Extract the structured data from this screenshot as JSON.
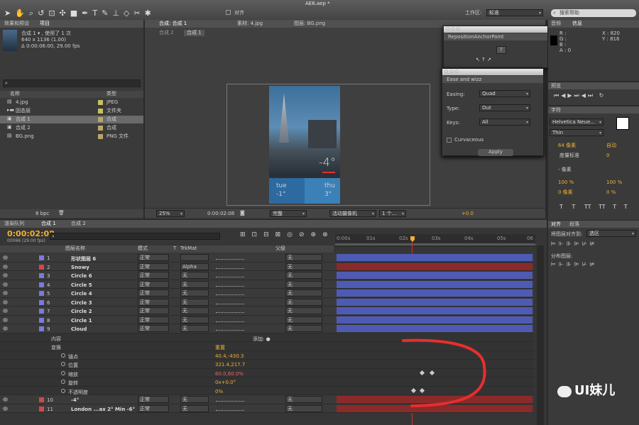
{
  "app": {
    "title": "AE6.aep *",
    "workspace_label": "工作区:",
    "workspace_value": "标准",
    "search_placeholder": "搜索帮助",
    "align_label": "对齐"
  },
  "project": {
    "tabs": [
      "效果和预设",
      "项目"
    ],
    "comp_name": "合成 1 ▾ , 使用了 1 次",
    "comp_size": "640 x 1136 (1.00)",
    "comp_duration": "Δ 0:00:06:00, 29.00 fps",
    "col_name": "名称",
    "col_type": "类型",
    "bpc": "8 bpc",
    "items": [
      {
        "name": "4.jpg",
        "type": "JPEG",
        "color": "#c8c062"
      },
      {
        "name": "固态层",
        "type": "文件夹",
        "color": "#c8c062"
      },
      {
        "name": "合成 1",
        "type": "合成",
        "color": "#b9a66a"
      },
      {
        "name": "合成 2",
        "type": "合成",
        "color": "#b9a66a"
      },
      {
        "name": "BG.png",
        "type": "PNG 文件",
        "color": "#b9a66a"
      }
    ]
  },
  "viewer": {
    "tabs": [
      "合成: 合成 1",
      "素材: 4.jpg",
      "图层: BG.png"
    ],
    "subtabs": [
      "合成 2",
      "合成 1"
    ],
    "zoom": "25%",
    "timecode": "0:00:02:08",
    "quality": "完整",
    "camera": "活动摄像机",
    "views": "1 个...",
    "exposure": "+0.0",
    "preview": {
      "temp": "-4°",
      "day1": "tue",
      "day1_temp": "-1°",
      "day2": "thu",
      "day2_temp": "3°"
    }
  },
  "anchor_panel": {
    "title": "RepositionAnchorPoint",
    "button": "?"
  },
  "ease_panel": {
    "title": "Ease and wizz",
    "easing_label": "Easing:",
    "easing": "Quad",
    "type_label": "Type:",
    "type": "Out",
    "keys_label": "Keys:",
    "keys": "All",
    "curvaceous": "Curvaceous",
    "apply": "Apply"
  },
  "info": {
    "tabs": [
      "音频",
      "信息"
    ],
    "r": "R :",
    "g": "G :",
    "b": "B :",
    "a": "A : 0",
    "x": "X : 820",
    "y": "Y : 816"
  },
  "preview_panel": {
    "title": "预览"
  },
  "char": {
    "title": "字符",
    "font": "Helvetica Neue...",
    "style": "Thin",
    "size": "64 像素",
    "leading": "自动",
    "tracking_label": "度量标准",
    "tracking": "0",
    "stroke": "- 像素",
    "vscale": "100 %",
    "hscale": "100 %",
    "baseline": "0 像素",
    "tsume": "0 %",
    "styles": [
      "T",
      "T",
      "TT",
      "TT",
      "T",
      "T",
      "T"
    ]
  },
  "align": {
    "tabs": [
      "对齐",
      "段落"
    ],
    "align_to_label": "将图层对齐到:",
    "align_to": "选区",
    "distribute_label": "分布图层:"
  },
  "timeline": {
    "tabs": [
      "渲染队列",
      "合成 1",
      "合成 2"
    ],
    "timecode": "0:00:02:08",
    "frames": "00066 (29.00 fps)",
    "search_placeholder": "",
    "cols": {
      "name": "图层名称",
      "mode": "模式",
      "t": "T",
      "trkmat": "TrkMat",
      "parent": "父级"
    },
    "ruler": [
      "0:00s",
      "01s",
      "02s",
      "03s",
      "04s",
      "05s",
      "06"
    ],
    "layers": [
      {
        "num": "1",
        "name": "形状图层 6",
        "color": "#7a7adb",
        "mode": "正常",
        "trk": "",
        "parent": "无",
        "star": true
      },
      {
        "num": "2",
        "name": "Snowy",
        "color": "#d04848",
        "mode": "正常",
        "trk": "Alpha",
        "parent": "无",
        "star": true
      },
      {
        "num": "3",
        "name": "Circle 6",
        "color": "#7a7adb",
        "mode": "正常",
        "trk": "无",
        "parent": "无",
        "star": true
      },
      {
        "num": "4",
        "name": "Circle 5",
        "color": "#7a7adb",
        "mode": "正常",
        "trk": "无",
        "parent": "无",
        "star": true
      },
      {
        "num": "5",
        "name": "Circle 4",
        "color": "#7a7adb",
        "mode": "正常",
        "trk": "无",
        "parent": "无",
        "star": true
      },
      {
        "num": "6",
        "name": "Circle 3",
        "color": "#7a7adb",
        "mode": "正常",
        "trk": "无",
        "parent": "无",
        "star": true
      },
      {
        "num": "7",
        "name": "Circle 2",
        "color": "#7a7adb",
        "mode": "正常",
        "trk": "无",
        "parent": "无",
        "star": true
      },
      {
        "num": "8",
        "name": "Circle 1",
        "color": "#7a7adb",
        "mode": "正常",
        "trk": "无",
        "parent": "无",
        "star": true
      },
      {
        "num": "9",
        "name": "Cloud",
        "color": "#7a7adb",
        "mode": "正常",
        "trk": "无",
        "parent": "无",
        "star": true
      }
    ],
    "props": [
      {
        "label": "内容",
        "value": "",
        "extra": "添加: ●"
      },
      {
        "label": "变换",
        "value": "重置",
        "extra": ""
      },
      {
        "label": "锚点",
        "value": "40.4,-430.3",
        "extra": ""
      },
      {
        "label": "位置",
        "value": "321.4,217.7",
        "extra": ""
      },
      {
        "label": "缩放",
        "value": "60.0,60.0%",
        "extra": ""
      },
      {
        "label": "旋转",
        "value": "0x+0.0°",
        "extra": ""
      },
      {
        "label": "不透明度",
        "value": "0%",
        "extra": ""
      }
    ],
    "layers_bottom": [
      {
        "num": "10",
        "name": "-4°",
        "color": "#d04848",
        "mode": "正常",
        "trk": "无",
        "parent": "无"
      },
      {
        "num": "11",
        "name": "London ...ax 2° Min -6°",
        "color": "#d04848",
        "mode": "正常",
        "trk": "无",
        "parent": "无"
      }
    ]
  },
  "watermark": "UI妹儿",
  "colors": {
    "accent": "#f0b030",
    "layer_bar": "#4e5bb5",
    "red_bar": "#8b2a2a",
    "annotation": "#e82e2e"
  }
}
